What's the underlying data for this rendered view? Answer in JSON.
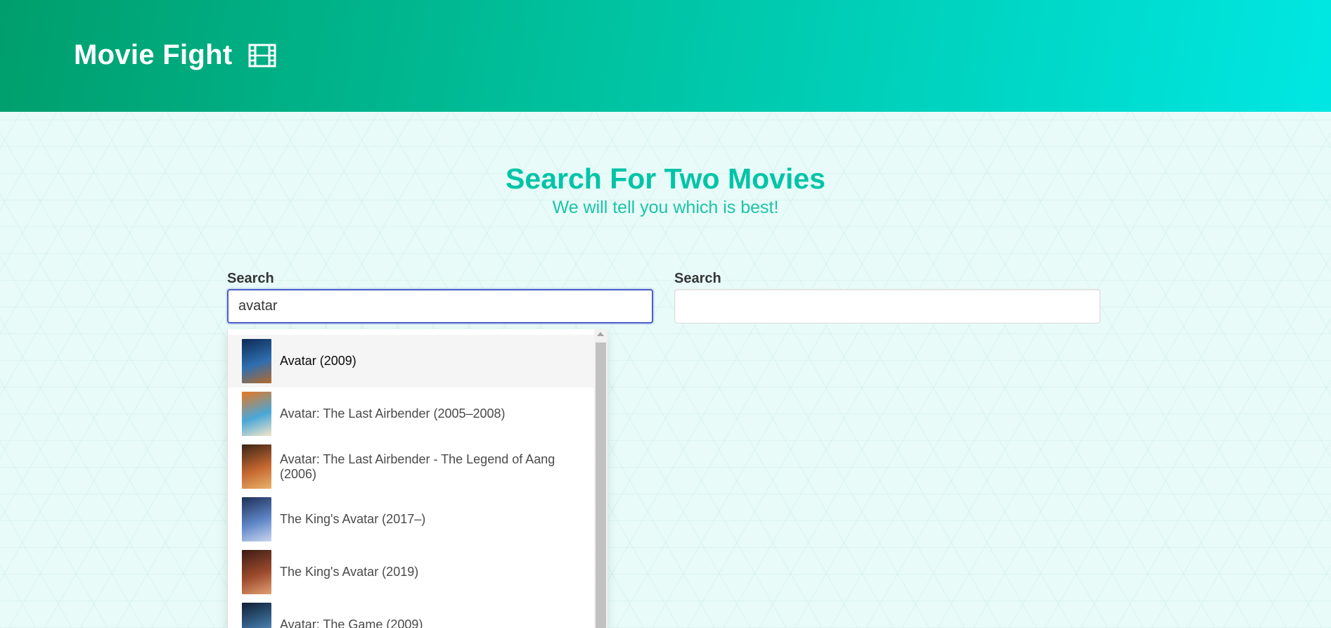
{
  "header": {
    "title": "Movie Fight",
    "icon": "film-icon"
  },
  "intro": {
    "title": "Search For Two Movies",
    "subtitle": "We will tell you which is best!"
  },
  "search_left": {
    "label": "Search",
    "value": "avatar"
  },
  "search_right": {
    "label": "Search",
    "value": ""
  },
  "results": [
    {
      "title": "Avatar (2009)",
      "poster_colors": [
        "#0c2a55",
        "#2f6fb0",
        "#b56a2a"
      ]
    },
    {
      "title": "Avatar: The Last Airbender (2005–2008)",
      "poster_colors": [
        "#e8771f",
        "#49a7d8",
        "#f3e7c9"
      ]
    },
    {
      "title": "Avatar: The Last Airbender - The Legend of Aang (2006)",
      "poster_colors": [
        "#3a2418",
        "#c4672f",
        "#e8b36a"
      ]
    },
    {
      "title": "The King's Avatar (2017–)",
      "poster_colors": [
        "#1d2f57",
        "#5f86c7",
        "#c9d6ef"
      ]
    },
    {
      "title": "The King's Avatar (2019)",
      "poster_colors": [
        "#3b1c14",
        "#9c4a2c",
        "#e1a071"
      ]
    },
    {
      "title": "Avatar: The Game (2009)",
      "poster_colors": [
        "#0f1f34",
        "#3c6f9c",
        "#a7c6e3"
      ]
    }
  ],
  "colors": {
    "hero_start": "#009e6c",
    "hero_end": "#00e7e3",
    "accent": "#00c4a7",
    "focus_border": "#485fc7"
  }
}
